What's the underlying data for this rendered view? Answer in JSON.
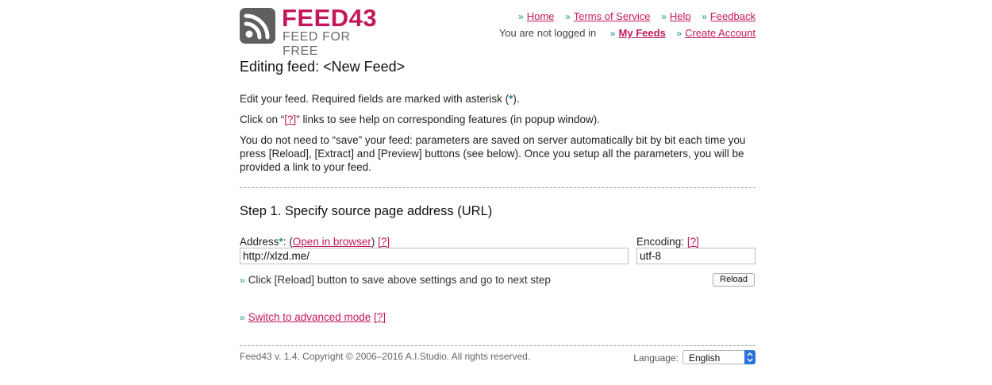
{
  "logo": {
    "title": "FEED43",
    "subtitle": "FEED FOR FREE",
    "icon": "rss-icon"
  },
  "nav": {
    "home": "Home",
    "terms": "Terms of Service",
    "help": "Help",
    "feedback": "Feedback",
    "status": "You are not logged in",
    "my_feeds": "My Feeds",
    "create_account": "Create Account"
  },
  "page_title": "Editing feed: <New Feed>",
  "intro": {
    "p1_before": "Edit your feed. Required fields are marked with asterisk (",
    "p1_star": "*",
    "p1_after": ").",
    "p2_before": "Click on “",
    "p2_link": "[?]",
    "p2_after": "” links to see help on corresponding features (in popup window).",
    "p3": "You do not need to “save” your feed: parameters are saved on server automatically bit by bit each time you press [Reload], [Extract] and [Preview] buttons (see below). Once you setup all the parameters, you will be provided a link to your feed."
  },
  "step1": {
    "title": "Step 1. Specify source page address (URL)",
    "address_label": "Address",
    "address_star": "*",
    "address_colon": ": (",
    "open_in_browser": "Open in browser",
    "address_close": ")",
    "address_help": "[?]",
    "address_value": "http://xlzd.me/",
    "encoding_label": "Encoding:",
    "encoding_help": "[?]",
    "encoding_value": "utf-8",
    "hint": "Click [Reload] button to save above settings and go to next step",
    "reload_label": "Reload"
  },
  "advanced": {
    "link": "Switch to advanced mode",
    "help": "[?]"
  },
  "footer": {
    "copyright": "Feed43 v. 1.4. Copyright © 2006–2016 A.I.Studio. All rights reserved.",
    "language_label": "Language:",
    "language_value": "English"
  },
  "colors": {
    "accent": "#c2185b",
    "bullet": "#1f8f8f",
    "logo_box": "#5f5f5f",
    "select_arrow": "#2b74d9"
  }
}
